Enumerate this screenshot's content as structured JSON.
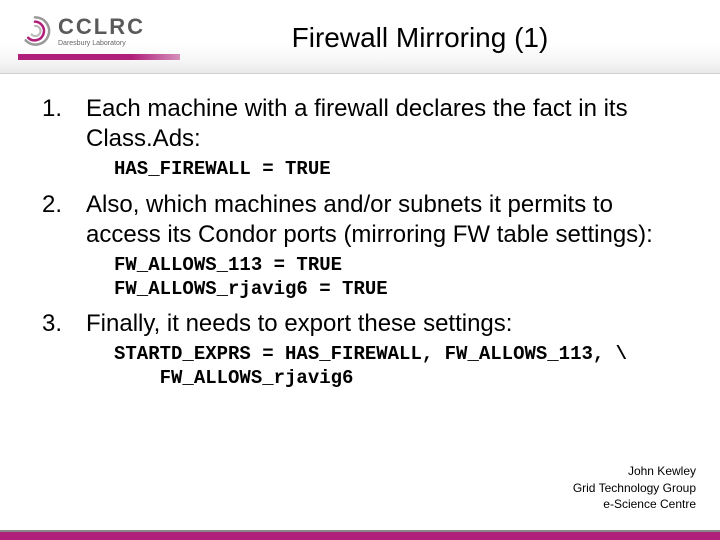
{
  "header": {
    "logo_main": "CCLRC",
    "logo_sub": "Daresbury Laboratory",
    "title": "Firewall Mirroring (1)"
  },
  "items": [
    {
      "text": "Each machine with a firewall declares the fact in its Class.Ads:",
      "code": "HAS_FIREWALL = TRUE"
    },
    {
      "text": "Also, which machines and/or subnets it permits to access its Condor ports (mirroring FW table settings):",
      "code": "FW_ALLOWS_113 = TRUE\nFW_ALLOWS_rjavig6 = TRUE"
    },
    {
      "text": "Finally, it needs to export these settings:",
      "code": "STARTD_EXPRS = HAS_FIREWALL, FW_ALLOWS_113, \\\n    FW_ALLOWS_rjavig6"
    }
  ],
  "footer": {
    "line1": "John Kewley",
    "line2": "Grid Technology Group",
    "line3": "e-Science Centre"
  }
}
